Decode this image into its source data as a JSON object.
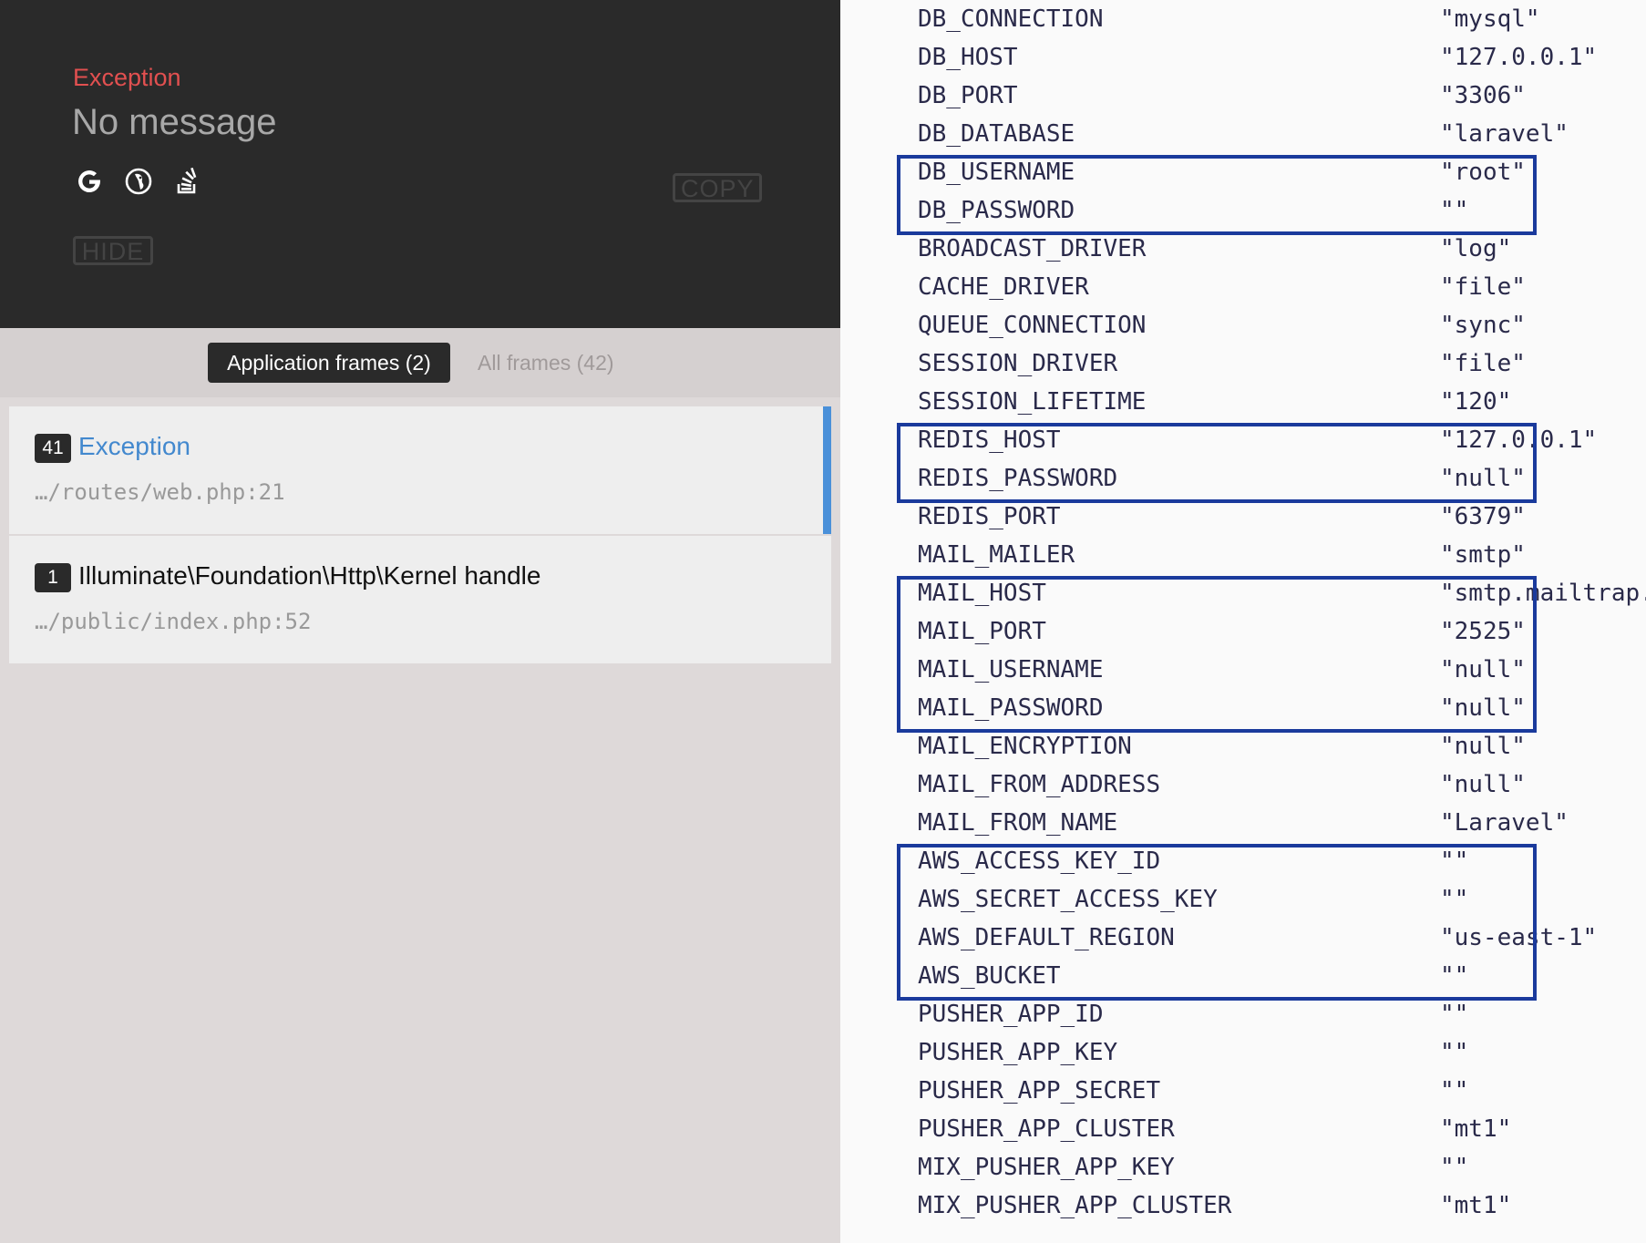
{
  "exception": {
    "class_name": "Exception",
    "message": "No message",
    "copy_label": "COPY",
    "hide_label": "HIDE",
    "search_icons": [
      "google-icon",
      "duckduckgo-icon",
      "stackoverflow-icon"
    ]
  },
  "tabs": {
    "application_frames": "Application frames (2)",
    "all_frames": "All frames (42)"
  },
  "frames": [
    {
      "number": "41",
      "name": "Exception",
      "path": "…/routes/web.php:21",
      "active": true
    },
    {
      "number": "1",
      "name": "Illuminate\\Foundation\\Http\\Kernel handle",
      "path": "…/public/index.php:52",
      "active": false
    }
  ],
  "env": [
    {
      "key": "DB_CONNECTION",
      "value": "\"mysql\""
    },
    {
      "key": "DB_HOST",
      "value": "\"127.0.0.1\""
    },
    {
      "key": "DB_PORT",
      "value": "\"3306\""
    },
    {
      "key": "DB_DATABASE",
      "value": "\"laravel\""
    },
    {
      "key": "DB_USERNAME",
      "value": "\"root\""
    },
    {
      "key": "DB_PASSWORD",
      "value": "\"\""
    },
    {
      "key": "BROADCAST_DRIVER",
      "value": "\"log\""
    },
    {
      "key": "CACHE_DRIVER",
      "value": "\"file\""
    },
    {
      "key": "QUEUE_CONNECTION",
      "value": "\"sync\""
    },
    {
      "key": "SESSION_DRIVER",
      "value": "\"file\""
    },
    {
      "key": "SESSION_LIFETIME",
      "value": "\"120\""
    },
    {
      "key": "REDIS_HOST",
      "value": "\"127.0.0.1\""
    },
    {
      "key": "REDIS_PASSWORD",
      "value": "\"null\""
    },
    {
      "key": "REDIS_PORT",
      "value": "\"6379\""
    },
    {
      "key": "MAIL_MAILER",
      "value": "\"smtp\""
    },
    {
      "key": "MAIL_HOST",
      "value": "\"smtp.mailtrap.io\""
    },
    {
      "key": "MAIL_PORT",
      "value": "\"2525\""
    },
    {
      "key": "MAIL_USERNAME",
      "value": "\"null\""
    },
    {
      "key": "MAIL_PASSWORD",
      "value": "\"null\""
    },
    {
      "key": "MAIL_ENCRYPTION",
      "value": "\"null\""
    },
    {
      "key": "MAIL_FROM_ADDRESS",
      "value": "\"null\""
    },
    {
      "key": "MAIL_FROM_NAME",
      "value": "\"Laravel\""
    },
    {
      "key": "AWS_ACCESS_KEY_ID",
      "value": "\"\""
    },
    {
      "key": "AWS_SECRET_ACCESS_KEY",
      "value": "\"\""
    },
    {
      "key": "AWS_DEFAULT_REGION",
      "value": "\"us-east-1\""
    },
    {
      "key": "AWS_BUCKET",
      "value": "\"\""
    },
    {
      "key": "PUSHER_APP_ID",
      "value": "\"\""
    },
    {
      "key": "PUSHER_APP_KEY",
      "value": "\"\""
    },
    {
      "key": "PUSHER_APP_SECRET",
      "value": "\"\""
    },
    {
      "key": "PUSHER_APP_CLUSTER",
      "value": "\"mt1\""
    },
    {
      "key": "MIX_PUSHER_APP_KEY",
      "value": "\"\""
    },
    {
      "key": "MIX_PUSHER_APP_CLUSTER",
      "value": "\"mt1\""
    }
  ],
  "highlight_groups": [
    {
      "start": 4,
      "end": 5
    },
    {
      "start": 11,
      "end": 12
    },
    {
      "start": 15,
      "end": 18
    },
    {
      "start": 22,
      "end": 25
    }
  ],
  "colors": {
    "exception_red": "#e25050",
    "active_frame_blue": "#4288ce",
    "highlight_box": "#1a3a9c"
  }
}
